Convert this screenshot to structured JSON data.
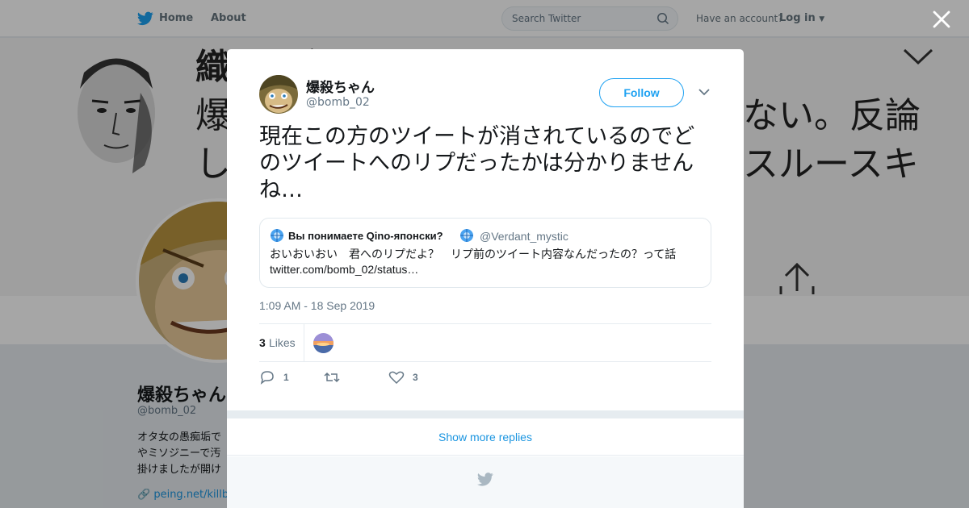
{
  "topnav": {
    "home_label": "Home",
    "about_label": "About",
    "search_placeholder": "Search Twitter",
    "have_account": "Have an account?",
    "login_label": "Log in"
  },
  "profile": {
    "name": "爆殺ちゃん",
    "handle": "@bomb_02",
    "bio": "オタ女の愚痴垢でやミソジニーで汚掛けましたが開け",
    "link": "peing.net/killbo",
    "banner_lines": [
      "織田三郎",
      "爆",
      "し"
    ],
    "banner_right_lines": [
      "ない。反論",
      "スルースキ"
    ]
  },
  "tweet": {
    "author_name": "爆殺ちゃん",
    "author_handle": "@bomb_02",
    "follow_label": "Follow",
    "text": "現在この方のツイートが消されているのでどのツイートへのリプだったかは分かりませんね…",
    "timestamp": "1:09 AM - 18 Sep 2019",
    "likes_count": "3",
    "likes_label": "Likes",
    "reply_count": "1",
    "retweet_count": "",
    "like_count": "3"
  },
  "quote": {
    "name": "Вы понимаете Qinо-японски?",
    "handle": "@Verdant_mystic",
    "text": "おいおいおい　君へのリプだよ？　リプ前のツイート内容なんだったの？って話",
    "link": "twitter.com/bomb_02/status…"
  },
  "more_replies_label": "Show more replies",
  "colors": {
    "accent": "#1da1f2",
    "link": "#1b95e0",
    "muted": "#657786"
  }
}
